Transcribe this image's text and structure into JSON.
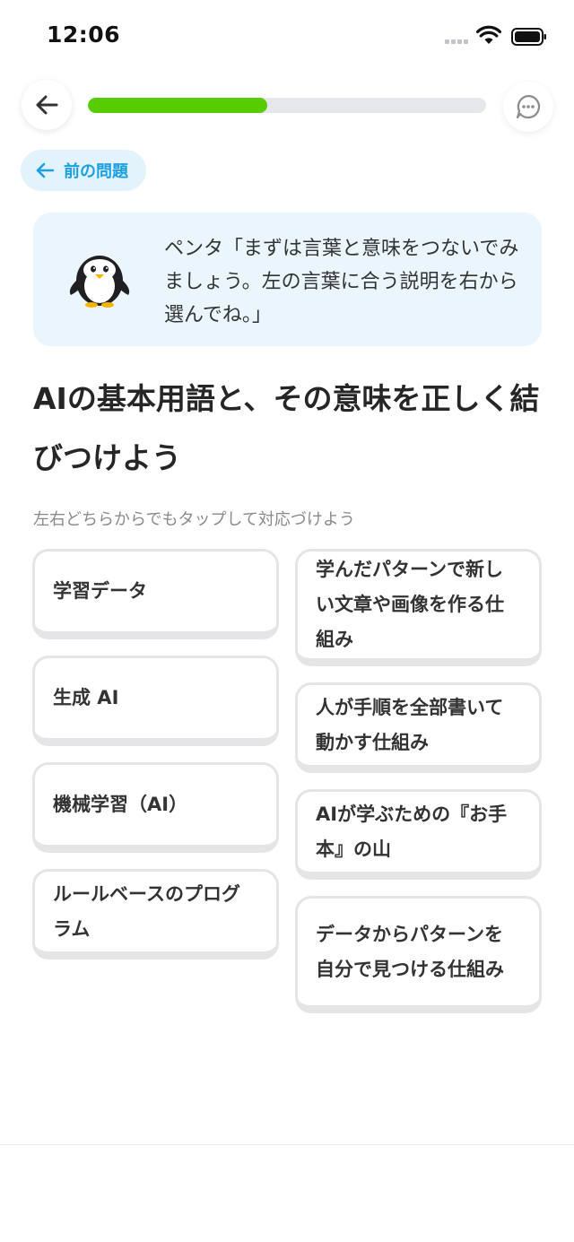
{
  "status": {
    "time": "12:06"
  },
  "progress": {
    "fraction": 0.45
  },
  "prev_question_label": "前の問題",
  "mascot": {
    "text": "ペンタ「まずは言葉と意味をつないでみましょう。左の言葉に合う説明を右から選んでね。」"
  },
  "question": {
    "title": "AIの基本用語と、その意味を正しく結びつけよう",
    "instruction": "左右どちらからでもタップして対応づけよう"
  },
  "terms": [
    "学習データ",
    "生成 AI",
    "機械学習（AI）",
    "ルールベースのプログラム"
  ],
  "definitions": [
    "学んだパターンで新しい文章や画像を作る仕組み",
    "人が手順を全部書いて動かす仕組み",
    "AIが学ぶための『お手本』の山",
    "データからパターンを自分で見つける仕組み"
  ],
  "colors": {
    "progress": "#58cc02",
    "accent": "#1c9fe0",
    "bubble_bg": "#eaf5fd"
  }
}
